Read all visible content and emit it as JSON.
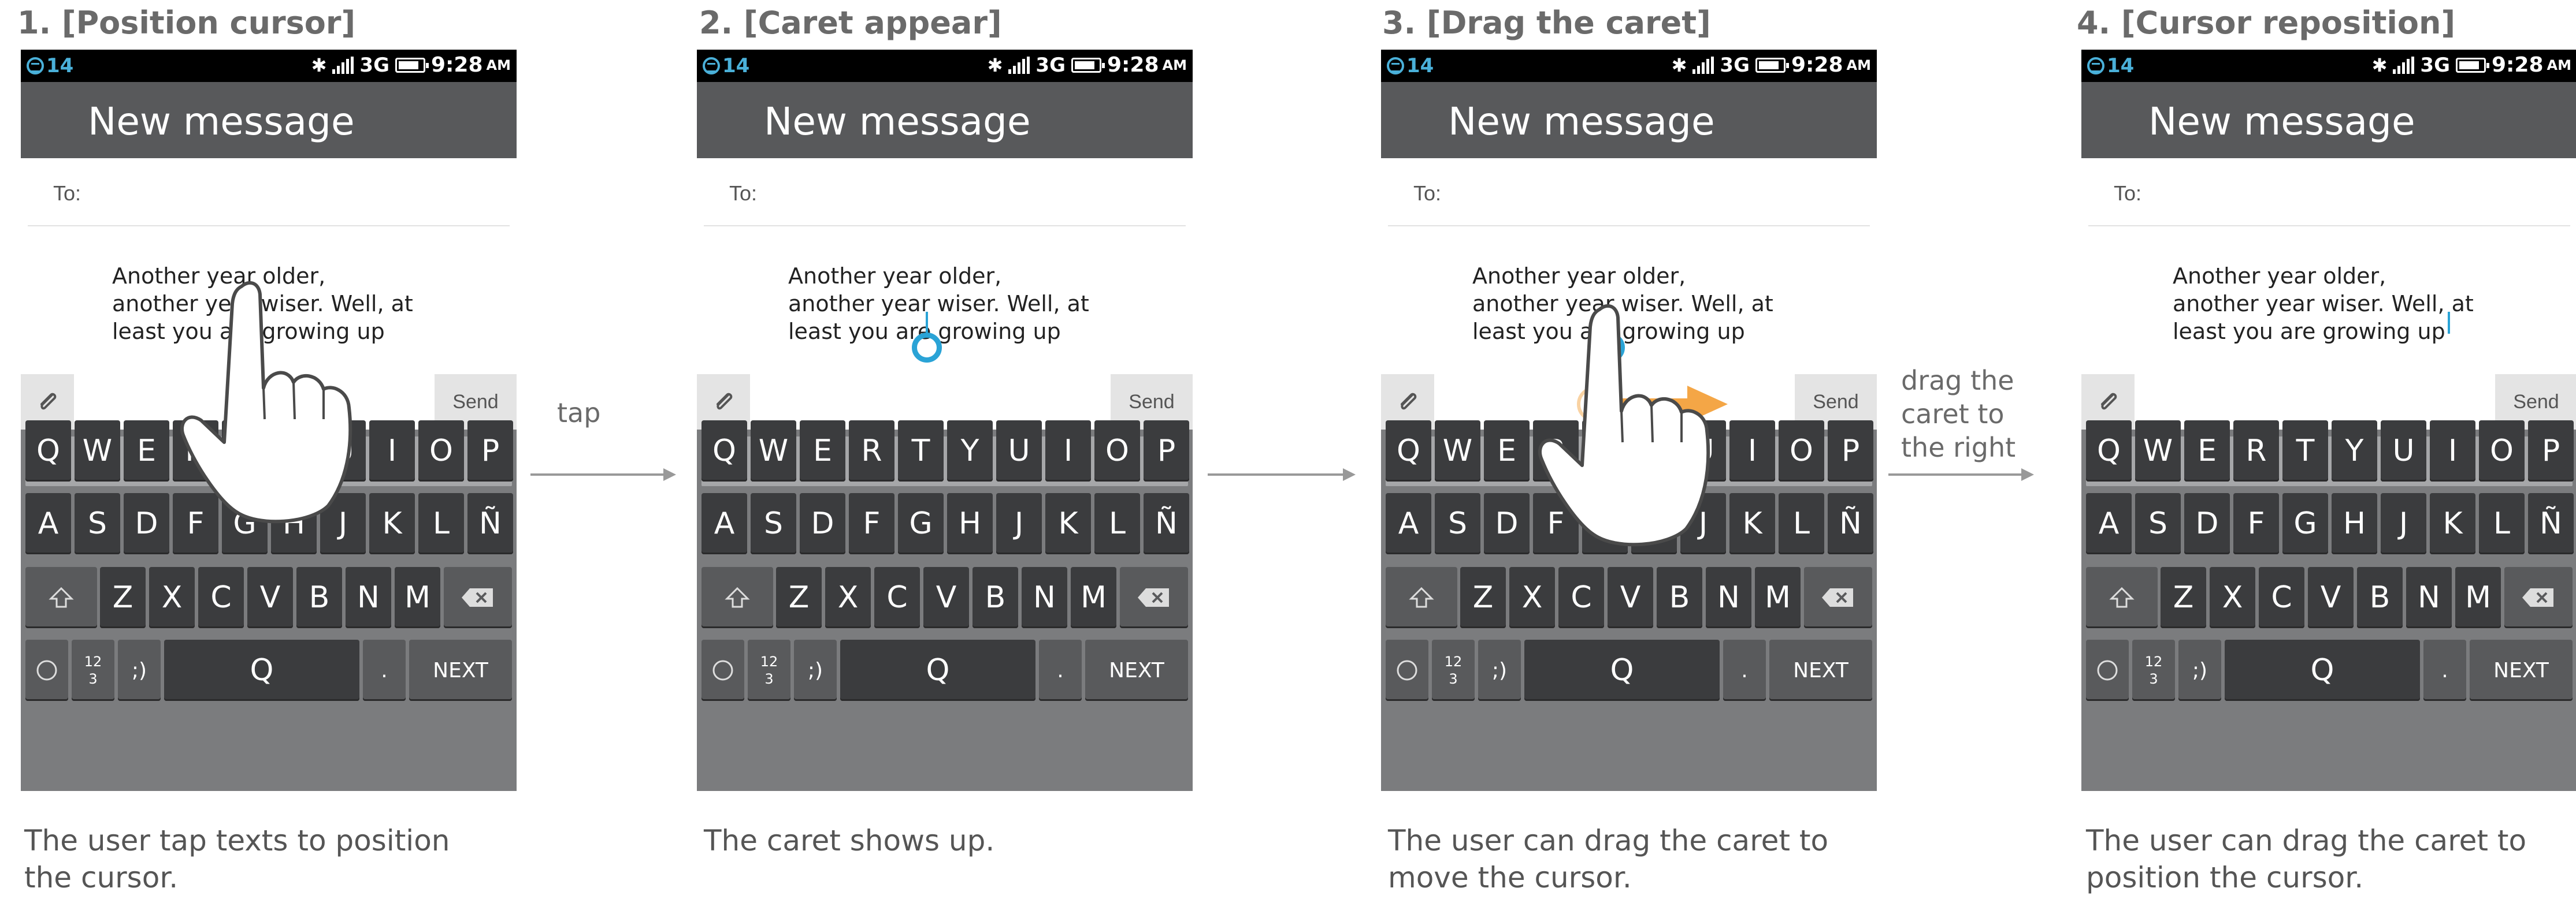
{
  "status_bar": {
    "notification_count": "14",
    "network": "3G",
    "time": "9:28",
    "ampm": "AM"
  },
  "compose": {
    "header_title": "New message",
    "to_label": "To:",
    "message_lines": [
      "Another year older,",
      "another year wiser. Well, at",
      "least you are growing up"
    ],
    "send_label": "Send"
  },
  "keyboard": {
    "row1": [
      "Q",
      "W",
      "E",
      "R",
      "T",
      "Y",
      "U",
      "I",
      "O",
      "P"
    ],
    "row2": [
      "A",
      "S",
      "D",
      "F",
      "G",
      "H",
      "J",
      "K",
      "L",
      "Ñ"
    ],
    "row3": [
      "Z",
      "X",
      "C",
      "V",
      "B",
      "N",
      "M"
    ],
    "numbers_top": "12",
    "numbers_bottom": "3",
    "emoticon_label": ";)",
    "space_label": "Q",
    "period_label": ".",
    "next_label": "NEXT"
  },
  "steps": [
    {
      "title": "1. [Position cursor]",
      "caption": [
        "The user tap texts to position",
        "the cursor."
      ]
    },
    {
      "title": "2. [Caret appear]",
      "caption": [
        "The caret shows up."
      ]
    },
    {
      "title": "3. [Drag the caret]",
      "caption": [
        "The user can drag the caret to",
        "move the cursor."
      ]
    },
    {
      "title": "4. [Cursor reposition]",
      "caption": [
        "The user can drag the caret to",
        "position the cursor."
      ]
    }
  ],
  "transitions": [
    {
      "label": [
        "tap"
      ]
    },
    {
      "label": []
    },
    {
      "label": [
        "drag the",
        "caret to",
        "the right"
      ]
    }
  ],
  "colors": {
    "caret": "#2aa3d6",
    "drag_arrow": "#f4a646",
    "header": "#58595b",
    "keyboard": "#7b7c7e"
  },
  "icons": [
    "bluetooth-icon",
    "signal-icon",
    "battery-icon",
    "attach-icon",
    "shift-icon",
    "backspace-icon",
    "globe-icon",
    "hand-pointer-icon"
  ]
}
